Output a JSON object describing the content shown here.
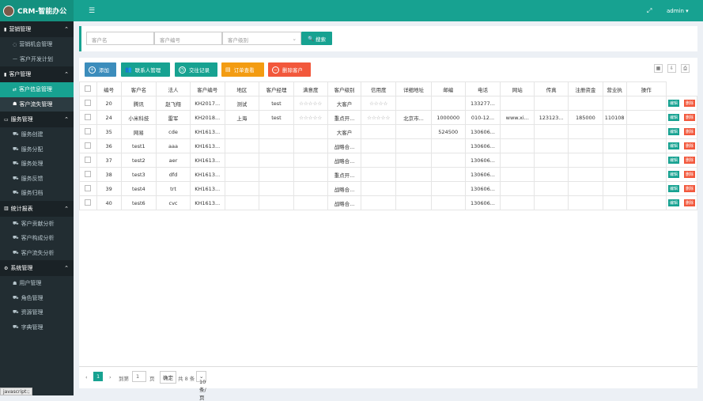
{
  "app": {
    "title": "CRM-智能办公",
    "user": "admin"
  },
  "sidebar": {
    "groups": [
      {
        "label": "营销管理",
        "items": [
          {
            "label": "营销机会管理"
          },
          {
            "label": "客户开发计划"
          }
        ]
      },
      {
        "label": "客户管理",
        "items": [
          {
            "label": "客户信息管理"
          },
          {
            "label": "客户流失管理"
          }
        ]
      },
      {
        "label": "服务管理",
        "items": [
          {
            "label": "服务创建"
          },
          {
            "label": "服务分配"
          },
          {
            "label": "服务处理"
          },
          {
            "label": "服务反馈"
          },
          {
            "label": "服务归档"
          }
        ]
      },
      {
        "label": "统计报表",
        "items": [
          {
            "label": "客户贡献分析"
          },
          {
            "label": "客户构成分析"
          },
          {
            "label": "客户流失分析"
          }
        ]
      },
      {
        "label": "系统管理",
        "items": [
          {
            "label": "用户管理"
          },
          {
            "label": "角色管理"
          },
          {
            "label": "资源管理"
          },
          {
            "label": "字典管理"
          }
        ]
      }
    ]
  },
  "search": {
    "name_placeholder": "客户名",
    "id_placeholder": "客户编号",
    "level_placeholder": "客户级别",
    "button": "搜索"
  },
  "toolbar": {
    "add": "添加",
    "contacts": "联系人管理",
    "records": "交往记录",
    "orders": "订单查看",
    "delete": "删除客户"
  },
  "table": {
    "headers": [
      "编号",
      "客户名",
      "法人",
      "客户编号",
      "地区",
      "客户经理",
      "满意度",
      "客户级别",
      "信用度",
      "详细地址",
      "邮编",
      "电话",
      "网站",
      "传真",
      "注册资金",
      "营业执",
      "操作"
    ],
    "rows": [
      [
        "20",
        "腾讯",
        "赵飞翔",
        "KH2017...",
        "测试",
        "test",
        "☆☆☆☆☆",
        "大客户",
        "☆☆☆☆",
        "",
        "",
        "133277...",
        "",
        "",
        "",
        "",
        ""
      ],
      [
        "24",
        "小米科技",
        "雷军",
        "KH2018...",
        "上海",
        "test",
        "☆☆☆☆☆",
        "重点开...",
        "☆☆☆☆☆",
        "北京市...",
        "1000000",
        "010-12...",
        "www.xi...",
        "123123...",
        "185000",
        "110108",
        ""
      ],
      [
        "35",
        "网易",
        "cde",
        "KH1613...",
        "",
        "",
        "",
        "大客户",
        "",
        "",
        "524500",
        "130606...",
        "",
        "",
        "",
        "",
        ""
      ],
      [
        "36",
        "test1",
        "aaa",
        "KH1613...",
        "",
        "",
        "",
        "战略合...",
        "",
        "",
        "",
        "130606...",
        "",
        "",
        "",
        "",
        ""
      ],
      [
        "37",
        "test2",
        "aer",
        "KH1613...",
        "",
        "",
        "",
        "战略合...",
        "",
        "",
        "",
        "130606...",
        "",
        "",
        "",
        "",
        ""
      ],
      [
        "38",
        "test3",
        "dfd",
        "KH1613...",
        "",
        "",
        "",
        "重点开...",
        "",
        "",
        "",
        "130606...",
        "",
        "",
        "",
        "",
        ""
      ],
      [
        "39",
        "test4",
        "trt",
        "KH1613...",
        "",
        "",
        "",
        "战略合...",
        "",
        "",
        "",
        "130606...",
        "",
        "",
        "",
        "",
        ""
      ],
      [
        "40",
        "test6",
        "cvc",
        "KH1613...",
        "",
        "",
        "",
        "战略合...",
        "",
        "",
        "",
        "130606...",
        "",
        "",
        "",
        "",
        ""
      ]
    ],
    "edit_label": "编辑",
    "delete_label": "删除"
  },
  "pager": {
    "current_page": "1",
    "goto_label": "到第",
    "goto_value": "1",
    "page_unit": "页",
    "confirm": "确定",
    "total": "共 8 条",
    "page_size": "10 条/页"
  },
  "statusbar": "javascript:;",
  "colors": {
    "accent": "#17a291",
    "sidebar": "#222d32",
    "add": "#3c8dbc",
    "orders": "#f39c12",
    "delete": "#f2583c"
  }
}
